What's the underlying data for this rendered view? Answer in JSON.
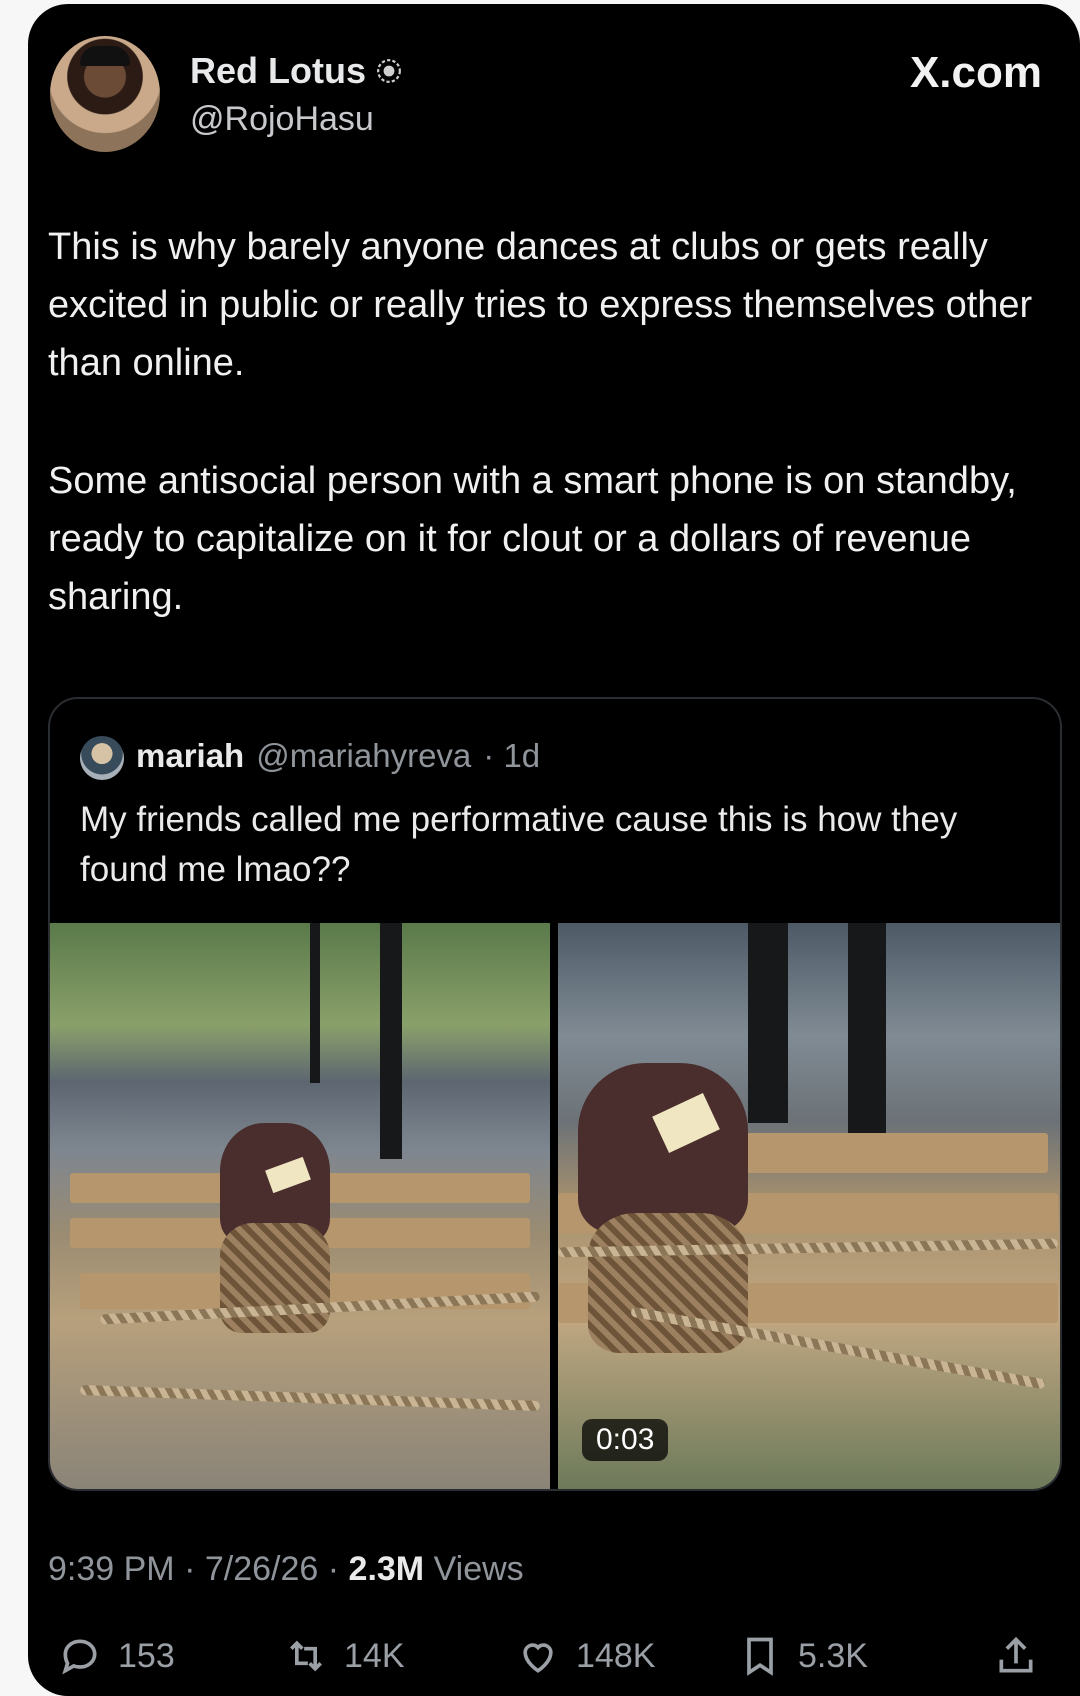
{
  "author": {
    "name": "Red Lotus",
    "handle": "@RojoHasu",
    "verified_icon": "verified-badge-icon"
  },
  "brand": "X.com",
  "tweet": {
    "paragraphs": [
      "This is why barely anyone dances at clubs or gets really excited in public or really tries to express themselves other than online.",
      "Some antisocial person with a smart phone is on standby, ready to capitalize on it for clout or a dollars of revenue sharing."
    ]
  },
  "quoted_tweet": {
    "name": "mariah",
    "handle": "@mariahyreva",
    "time": "· 1d",
    "text": "My friends called me performative cause this is how they found me lmao??",
    "video_duration": "0:03"
  },
  "meta": {
    "time": "9:39 PM",
    "date": "7/26/26",
    "views_count": "2.3M",
    "views_label": "Views"
  },
  "actions": {
    "replies": "153",
    "reposts": "14K",
    "likes": "148K",
    "bookmarks": "5.3K"
  },
  "colors": {
    "background": "#000000",
    "text": "#e7e9ea",
    "muted": "#8f959b",
    "border": "#2a2d31"
  }
}
